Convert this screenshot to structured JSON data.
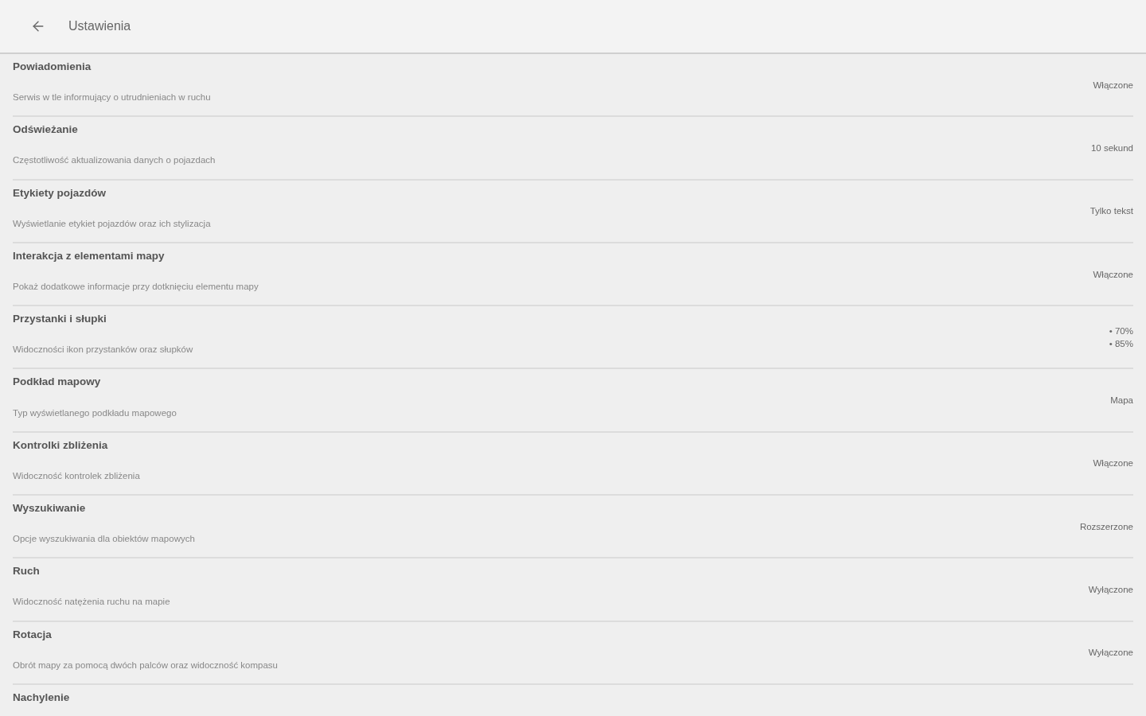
{
  "toolbar": {
    "title": "Ustawienia"
  },
  "settings": [
    {
      "title": "Powiadomienia",
      "description": "Serwis w tle informujący o utrudnieniach w ruchu",
      "values": [
        "Włączone"
      ]
    },
    {
      "title": "Odświeżanie",
      "description": "Częstotliwość aktualizowania danych o pojazdach",
      "values": [
        "10 sekund"
      ]
    },
    {
      "title": "Etykiety pojazdów",
      "description": "Wyświetlanie etykiet pojazdów oraz ich stylizacja",
      "values": [
        "Tylko tekst"
      ]
    },
    {
      "title": "Interakcja z elementami mapy",
      "description": "Pokaż dodatkowe informacje przy dotknięciu elementu mapy",
      "values": [
        "Włączone"
      ]
    },
    {
      "title": "Przystanki i słupki",
      "description": "Widoczności ikon przystanków oraz słupków",
      "values": [
        "• 70%",
        "• 85%"
      ]
    },
    {
      "title": "Podkład mapowy",
      "description": "Typ wyświetlanego podkładu mapowego",
      "values": [
        "Mapa"
      ]
    },
    {
      "title": "Kontrolki zbliżenia",
      "description": "Widoczność kontrolek zbliżenia",
      "values": [
        "Włączone"
      ]
    },
    {
      "title": "Wyszukiwanie",
      "description": "Opcje wyszukiwania dla obiektów mapowych",
      "values": [
        "Rozszerzone"
      ]
    },
    {
      "title": "Ruch",
      "description": "Widoczność natężenia ruchu na mapie",
      "values": [
        "Wyłączone"
      ]
    },
    {
      "title": "Rotacja",
      "description": "Obrót mapy za pomocą dwóch palców oraz widoczność kompasu",
      "values": [
        "Wyłączone"
      ]
    },
    {
      "title": "Nachylenie"
    }
  ]
}
